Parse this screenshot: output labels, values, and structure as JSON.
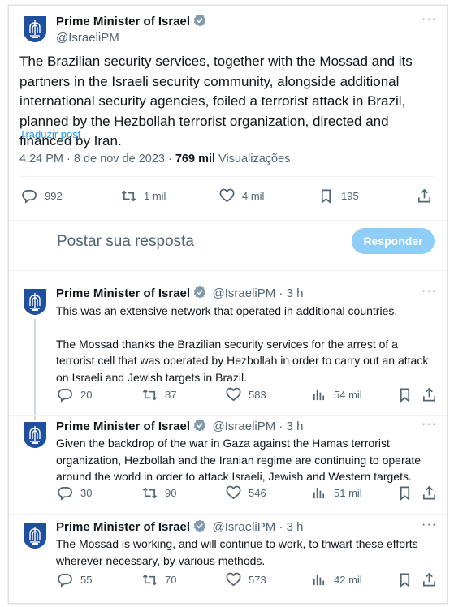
{
  "account": {
    "name": "Prime Minister of Israel",
    "handle": "@IsraeliPM"
  },
  "main_tweet": {
    "text": "The Brazilian security services, together with the Mossad and its partners in the Israeli security community, alongside additional international security agencies, foiled a terrorist attack in Brazil, planned by the Hezbollah terrorist organization, directed and financed by Iran.",
    "translate_label": "Traduzir post",
    "timestamp": "4:24 PM · 8 de nov de 2023 · ",
    "views_count": "769 mil",
    "views_label": " Visualizações",
    "replies": "992",
    "reposts": "1 mil",
    "likes": "4 mil",
    "bookmarks": "195"
  },
  "reply_box": {
    "placeholder": "Postar sua resposta",
    "button_label": "Responder"
  },
  "replies": [
    {
      "handle_time": "@IsraeliPM · 3 h",
      "para1": "This was an extensive network that operated in additional countries.",
      "para2": "The Mossad thanks the Brazilian security services for the arrest of a terrorist cell that was operated by Hezbollah in order to carry out an attack on Israeli and Jewish targets in Brazil.",
      "replies": "20",
      "reposts": "87",
      "likes": "583",
      "views": "54 mil"
    },
    {
      "handle_time": "@IsraeliPM · 3 h",
      "para1": "Given the backdrop of the war in Gaza against the Hamas terrorist organization, Hezbollah and the Iranian regime are continuing to operate around the world in order to attack Israeli, Jewish and Western targets.",
      "replies": "30",
      "reposts": "90",
      "likes": "546",
      "views": "51 mil"
    },
    {
      "handle_time": "@IsraeliPM · 3 h",
      "para1": "The Mossad is working, and will continue to work, to thwart these efforts wherever necessary, by various methods.",
      "replies": "55",
      "reposts": "70",
      "likes": "573",
      "views": "42 mil"
    }
  ],
  "colors": {
    "accent": "#1d9bf0",
    "button_disabled": "#8ecdf8",
    "secondary_text": "#536471",
    "emblem_blue": "#1f4f9e"
  },
  "icons": [
    "israel-emblem-icon",
    "verified-badge-icon",
    "more-icon",
    "reply-icon",
    "repost-icon",
    "like-icon",
    "bookmark-icon",
    "share-icon",
    "views-icon"
  ]
}
